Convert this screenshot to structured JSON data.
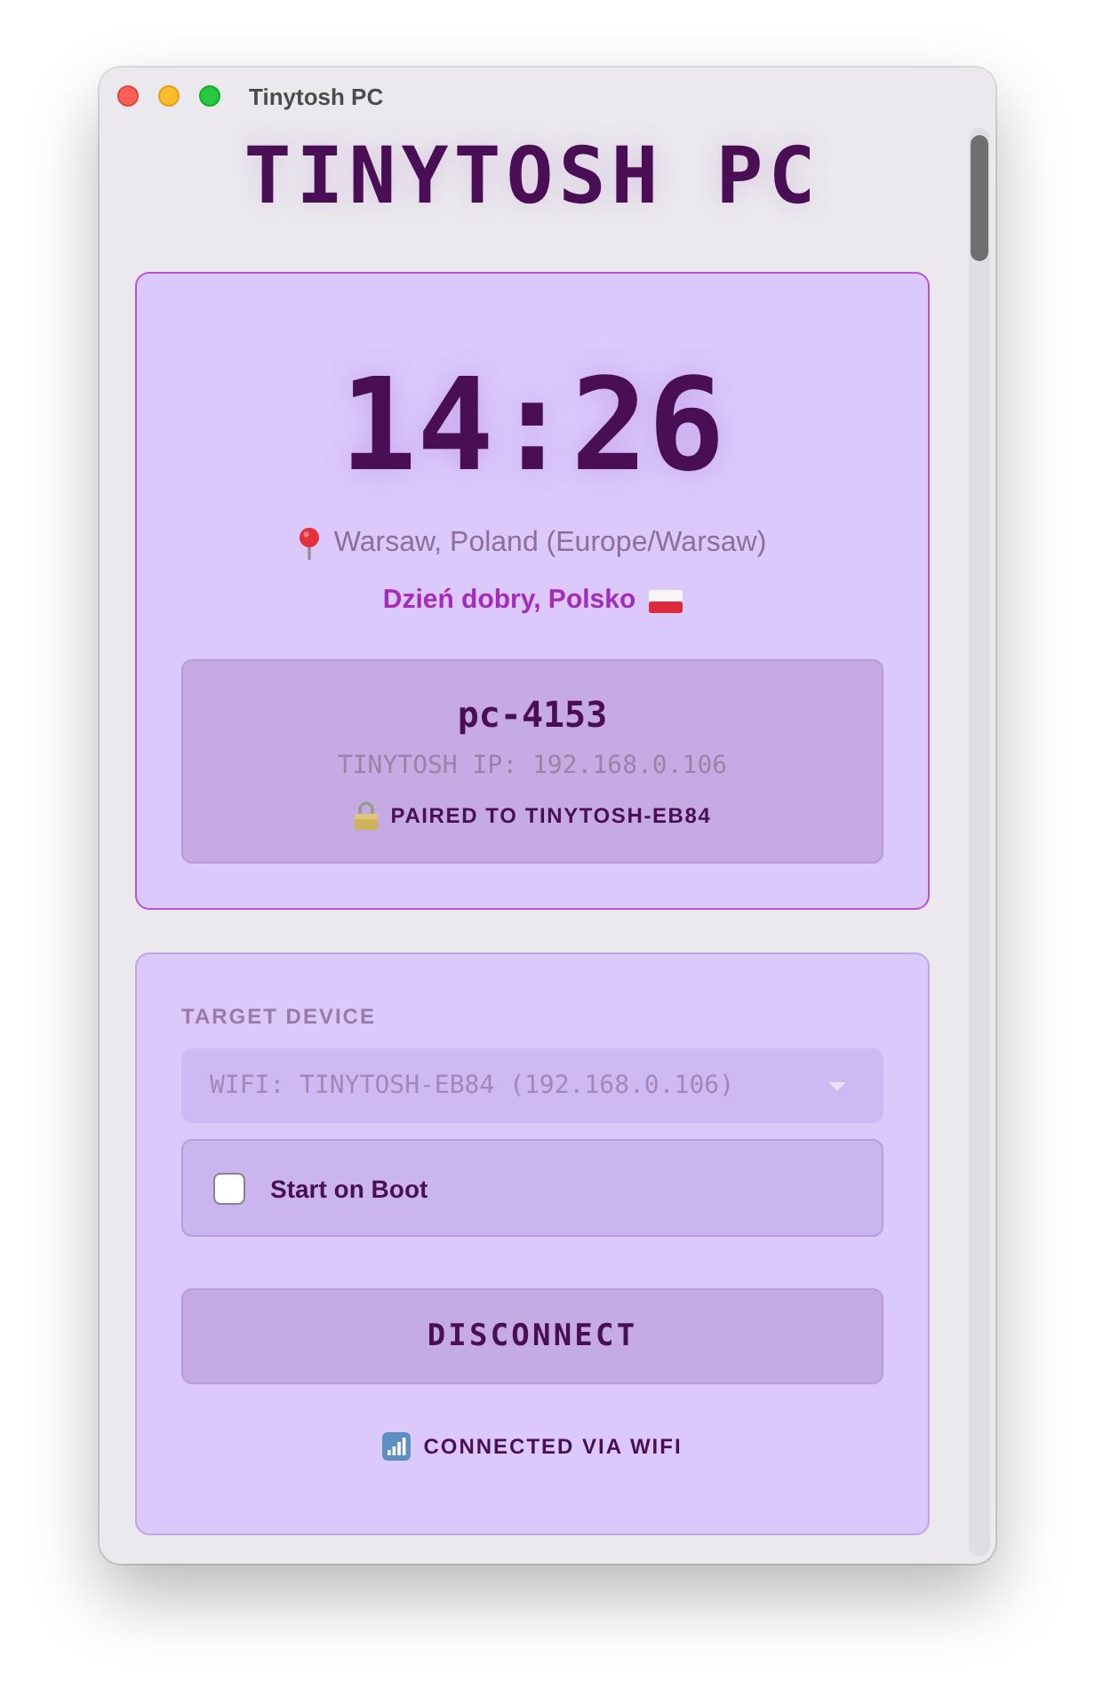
{
  "window": {
    "title": "Tinytosh PC"
  },
  "app_title": "TINYTOSH PC",
  "clock_card": {
    "time": "14:26",
    "location": "Warsaw, Poland (Europe/Warsaw)",
    "greeting": "Dzień dobry, Polsko",
    "device": {
      "name": "pc-4153",
      "ip": "TINYTOSH IP: 192.168.0.106",
      "pairing": "PAIRED TO TINYTOSH-EB84"
    }
  },
  "settings_card": {
    "target_label": "TARGET DEVICE",
    "target_select": {
      "value": "WIFI: TINYTOSH-EB84 (192.168.0.106)",
      "disabled": true
    },
    "start_on_boot": {
      "label": "Start on Boot",
      "checked": false
    },
    "disconnect_button": "DISCONNECT",
    "status": "CONNECTED VIA WIFI"
  }
}
